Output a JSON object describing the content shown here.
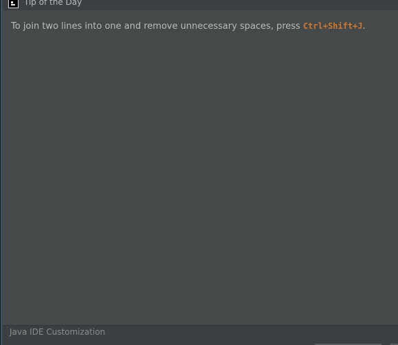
{
  "window": {
    "title": "Tip of the Day"
  },
  "tip": {
    "text": "To join two lines into one and remove unnecessary spaces, press ",
    "shortcut": "Ctrl+Shift+J",
    "suffix": "."
  },
  "footer": {
    "label": "Java IDE Customization"
  },
  "colors": {
    "background": "#3c3f41",
    "content": "#45494a",
    "text": "#bbbbbb",
    "shortcut": "#cc7832"
  },
  "icons": {
    "app": "app-icon"
  }
}
